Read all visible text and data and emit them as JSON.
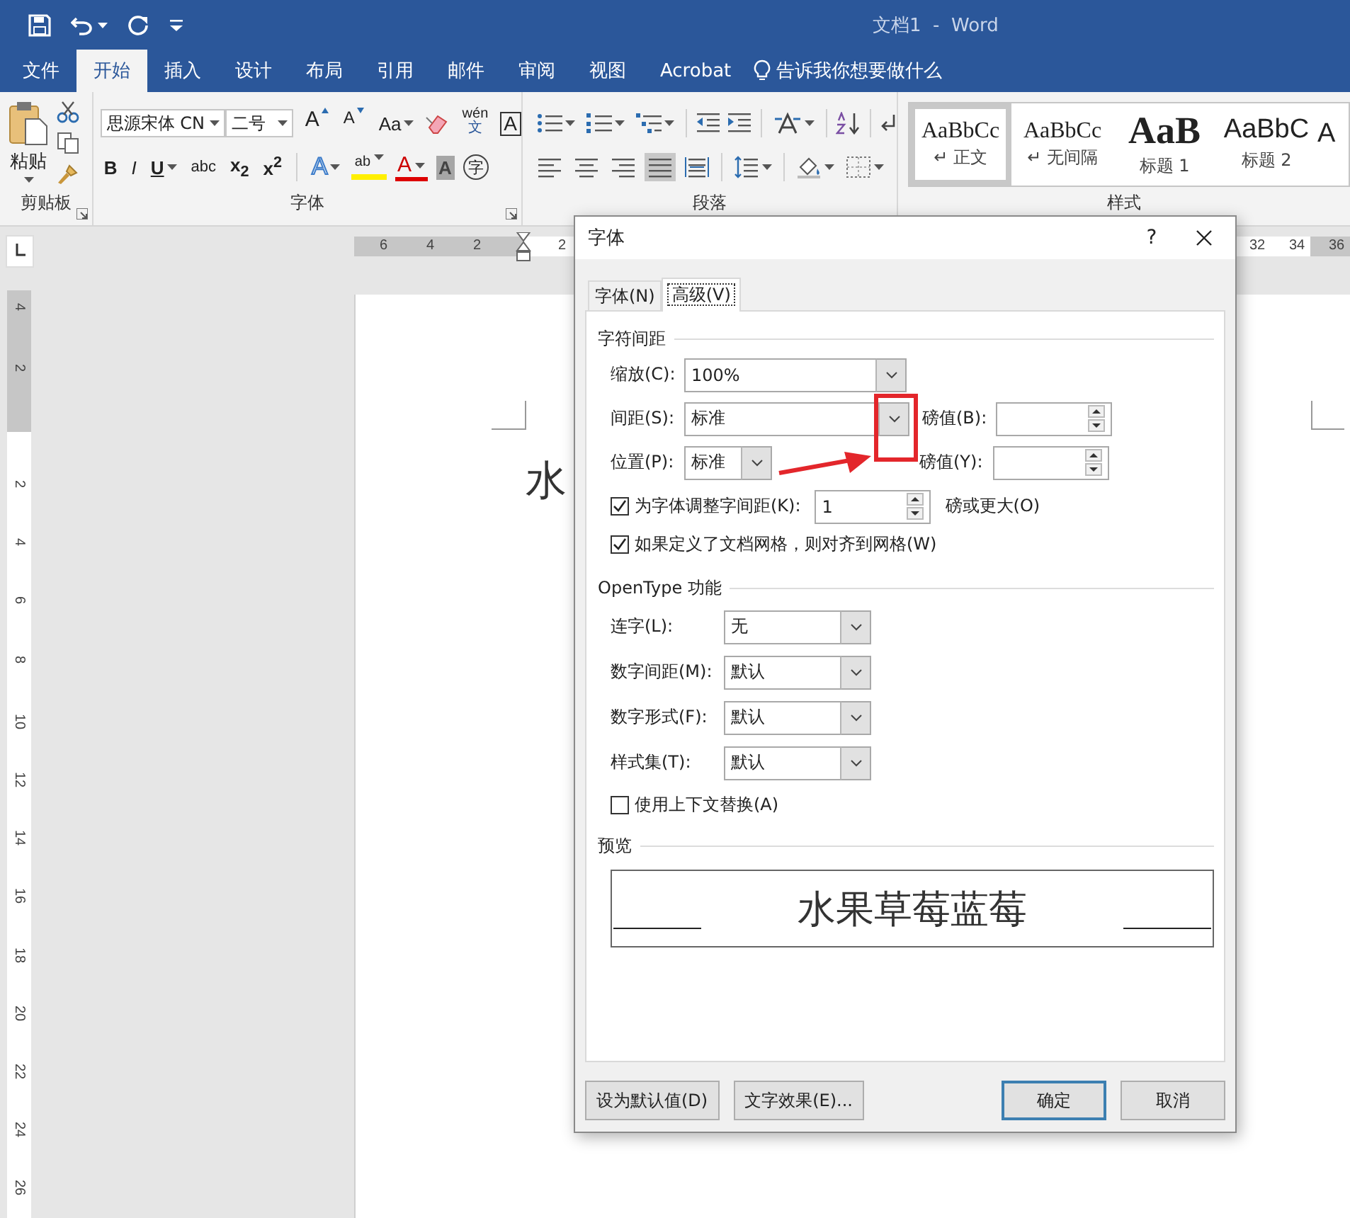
{
  "window": {
    "title": "文档1  -  Word"
  },
  "ribbon_tabs": [
    {
      "label": "文件",
      "selected": false
    },
    {
      "label": "开始",
      "selected": true
    },
    {
      "label": "插入",
      "selected": false
    },
    {
      "label": "设计",
      "selected": false
    },
    {
      "label": "布局",
      "selected": false
    },
    {
      "label": "引用",
      "selected": false
    },
    {
      "label": "邮件",
      "selected": false
    },
    {
      "label": "审阅",
      "selected": false
    },
    {
      "label": "视图",
      "selected": false
    },
    {
      "label": "Acrobat",
      "selected": false
    }
  ],
  "tell_me": "告诉我你想要做什么",
  "clipboard_group": {
    "paste": "粘贴",
    "label": "剪贴板"
  },
  "font_group": {
    "label": "字体",
    "font_name": "思源宋体 CN",
    "font_size": "二号",
    "row1": [
      {
        "kind": "grow",
        "text": "A"
      },
      {
        "kind": "shrink",
        "text": "A"
      },
      {
        "kind": "case",
        "text": "Aa"
      },
      {
        "kind": "clear"
      },
      {
        "kind": "phonetic",
        "text": "wén",
        "sub": "文"
      },
      {
        "kind": "border",
        "text": "A"
      }
    ],
    "row2": [
      {
        "kind": "bold",
        "text": "B"
      },
      {
        "kind": "italic",
        "text": "I"
      },
      {
        "kind": "underline",
        "text": "U"
      },
      {
        "kind": "strike",
        "text": "abc"
      },
      {
        "kind": "sub",
        "text": "x$_{2}$"
      },
      {
        "kind": "sup",
        "text": "x$^{2}$"
      },
      {
        "kind": "effect",
        "text": "A"
      },
      {
        "kind": "highlight",
        "text": "ab"
      },
      {
        "kind": "color",
        "text": "A"
      },
      {
        "kind": "shade",
        "text": "A"
      },
      {
        "kind": "enclose",
        "text": "字"
      }
    ]
  },
  "paragraph_group": {
    "label": "段落",
    "alignment": [
      {
        "selected": false
      },
      {
        "selected": false
      },
      {
        "selected": false
      },
      {
        "selected": true
      },
      {
        "selected": false
      }
    ]
  },
  "styles_group": {
    "label": "样式",
    "styles": [
      {
        "kind": "normal",
        "sample": "AaBbCc",
        "name": "↵ 正文",
        "selected": true
      },
      {
        "kind": "normal",
        "sample": "AaBbCc",
        "name": "↵ 无间隔",
        "selected": false
      },
      {
        "kind": "heading1",
        "sample": "AaB",
        "name": "标题 1",
        "selected": false
      },
      {
        "kind": "heading2",
        "sample": "AaBbC",
        "name": "标题 2",
        "selected": false
      },
      {
        "kind": "cut",
        "sample": "A",
        "selected": false
      }
    ]
  },
  "horizontal_ruler": {
    "left_labels": [
      "6",
      "4",
      "2"
    ],
    "indent_labels": [
      "2"
    ],
    "far_labels": [
      "32",
      "34",
      "36"
    ]
  },
  "vertical_ruler": {
    "top_labels": [
      "4",
      "2"
    ],
    "labels": [
      "2",
      "4",
      "6",
      "8",
      "10",
      "12",
      "14",
      "16",
      "18",
      "20",
      "22",
      "24",
      "26"
    ]
  },
  "document": {
    "text": "水"
  },
  "dialog": {
    "title": "字体",
    "help": "?",
    "tabs": [
      {
        "label": "字体(N)",
        "selected": false
      },
      {
        "label": "高级(V)",
        "selected": true
      }
    ],
    "character_spacing": {
      "title": "字符间距",
      "scale": {
        "label": "缩放(C):",
        "value": "100%"
      },
      "spacing": {
        "label": "间距(S):",
        "value": "标准",
        "by_label": "磅值(B):"
      },
      "position": {
        "label": "位置(P):",
        "value": "标准",
        "by_label": "磅值(Y):"
      },
      "kerning": {
        "label": "为字体调整字间距(K):",
        "checked": true,
        "value": "1",
        "suffix": "磅或更大(O)"
      },
      "snap_to_grid": {
        "label": "如果定义了文档网格，则对齐到网格(W)",
        "checked": true
      }
    },
    "opentype": {
      "title": "OpenType 功能",
      "fields": [
        {
          "label": "连字(L):",
          "value": "无"
        },
        {
          "label": "数字间距(M):",
          "value": "默认"
        },
        {
          "label": "数字形式(F):",
          "value": "默认"
        },
        {
          "label": "样式集(T):",
          "value": "默认"
        }
      ],
      "contextual_alternates": {
        "label": "使用上下文替换(A)",
        "checked": false
      }
    },
    "preview": {
      "title": "预览",
      "text": "水果草莓蓝莓"
    },
    "left_buttons": [
      {
        "label": "设为默认值(D)",
        "kind": "normal"
      },
      {
        "label": "文字效果(E)...",
        "kind": "normal"
      }
    ],
    "right_buttons": [
      {
        "label": "确定",
        "kind": "default"
      },
      {
        "label": "取消",
        "kind": "normal"
      }
    ]
  }
}
